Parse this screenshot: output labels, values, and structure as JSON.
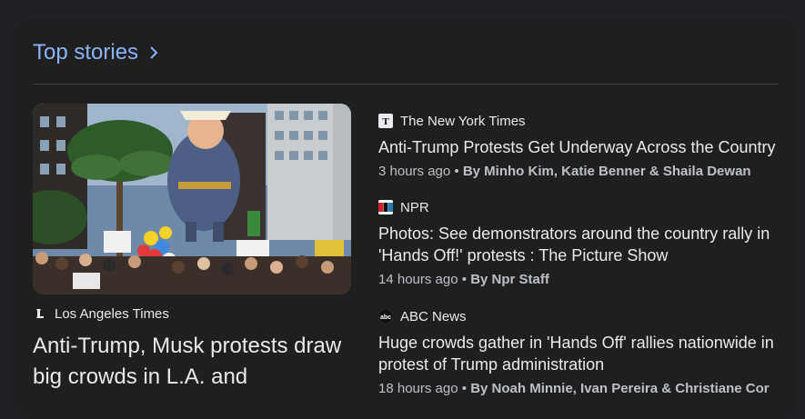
{
  "section": {
    "title": "Top stories"
  },
  "featured": {
    "source": "Los Angeles Times",
    "title": "Anti-Trump, Musk protests draw big crowds in L.A. and"
  },
  "stories": [
    {
      "source": "The New York Times",
      "title": "Anti-Trump Protests Get Underway Across the Country",
      "time": "3 hours ago",
      "separator": "•",
      "byline": "By Minho Kim, Katie Benner & Shaila Dewan"
    },
    {
      "source": "NPR",
      "title": "Photos: See demonstrators around the country rally in 'Hands Off!' protests : The Picture Show",
      "time": "14 hours ago",
      "separator": "•",
      "byline": "By Npr Staff"
    },
    {
      "source": "ABC News",
      "title": "Huge crowds gather in 'Hands Off' rallies nationwide in protest of Trump administration",
      "time": "18 hours ago",
      "separator": "•",
      "byline": "By Noah Minnie, Ivan Pereira & Christiane Cor"
    }
  ],
  "colors": {
    "accent": "#8ab4f8",
    "card": "#1f1f1f",
    "text": "#e8eaed",
    "meta": "#bdc1c6"
  }
}
